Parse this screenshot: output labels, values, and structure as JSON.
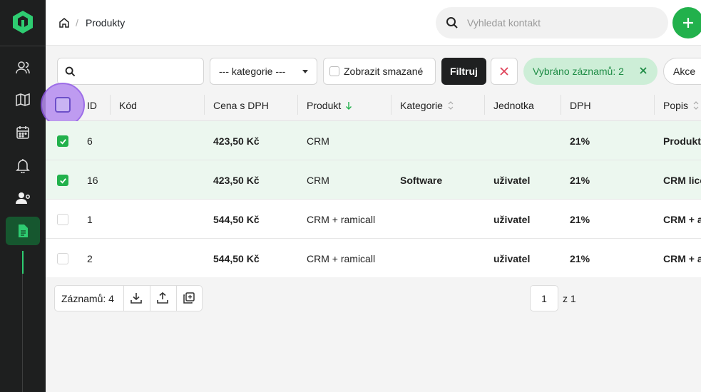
{
  "topbar": {
    "breadcrumb_page": "Produkty",
    "breadcrumb_sep": "/",
    "search_placeholder": "Vyhledat kontakt"
  },
  "toolbar": {
    "search_value": "",
    "category_select": "--- kategorie ---",
    "show_deleted_label": "Zobrazit smazané",
    "filter_label": "Filtruj",
    "selected_label": "Vybráno záznamů: 2",
    "actions_label": "Akce"
  },
  "table": {
    "columns": [
      "ID",
      "Kód",
      "Cena s DPH",
      "Produkt",
      "Kategorie",
      "Jednotka",
      "DPH",
      "Popis"
    ],
    "rows": [
      {
        "selected": true,
        "id": "6",
        "kod": "",
        "cena": "423,50 Kč",
        "produkt": "CRM",
        "kategorie": "",
        "jednotka": "",
        "dph": "21%",
        "popis": "Produkt"
      },
      {
        "selected": true,
        "id": "16",
        "kod": "",
        "cena": "423,50 Kč",
        "produkt": "CRM",
        "kategorie": "Software",
        "jednotka": "uživatel",
        "dph": "21%",
        "popis": "CRM lice"
      },
      {
        "selected": false,
        "id": "1",
        "kod": "",
        "cena": "544,50 Kč",
        "produkt": "CRM + ramicall",
        "kategorie": "",
        "jednotka": "uživatel",
        "dph": "21%",
        "popis": "CRM + a"
      },
      {
        "selected": false,
        "id": "2",
        "kod": "",
        "cena": "544,50 Kč",
        "produkt": "CRM + ramicall",
        "kategorie": "",
        "jednotka": "uživatel",
        "dph": "21%",
        "popis": "CRM + a"
      }
    ]
  },
  "footer": {
    "records_label": "Záznamů: 4",
    "page_value": "1",
    "page_of": "z 1"
  },
  "icons": {
    "sidebar": [
      "users-icon",
      "map-icon",
      "calendar-icon",
      "bell-icon",
      "user-settings-icon",
      "document-icon"
    ],
    "footer": [
      "download-icon",
      "upload-icon",
      "duplicate-icon"
    ]
  },
  "colors": {
    "accent_green": "#22b14c",
    "sidebar_bg": "#1e1f1f",
    "selected_row_bg": "#ecf7ef",
    "selected_chip_bg": "#cdeed7",
    "clear_red": "#e0435a"
  }
}
